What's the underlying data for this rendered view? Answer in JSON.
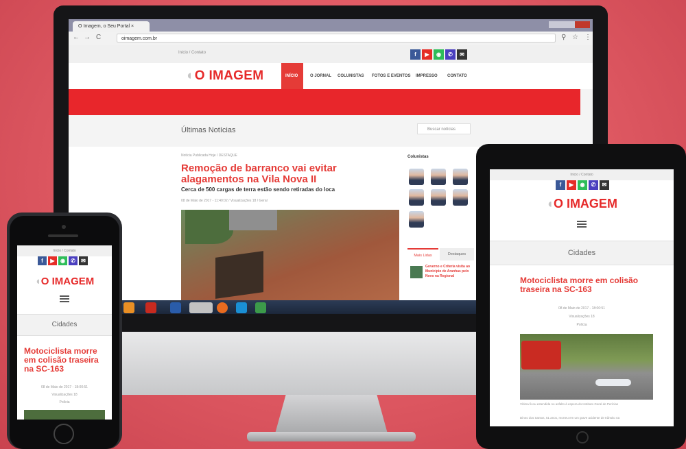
{
  "browser": {
    "tab_title": "O Imagem, o Seu Portal",
    "url": "oimagem.com.br"
  },
  "site": {
    "breadcrumb": "Inicio / Contato",
    "logo": "O IMAGEM",
    "menu": [
      "INÍCIO",
      "O JORNAL",
      "COLUNISTAS",
      "FOTOS E EVENTOS",
      "IMPRESSO",
      "CONTATO"
    ],
    "section_title": "Últimas Notícias",
    "search_placeholder": "Buscar notícias",
    "article": {
      "meta_top": "Notícia Publicada Hoje / DESTAQUE",
      "title": "Remoção de barranco vai evitar alagamentos na Vila Nova II",
      "subtitle": "Cerca de 500 cargas de terra estão sendo retiradas do loca",
      "meta": "08 de Maio de 2017 - 11:40:02 / Visualizações 18 / Geral"
    },
    "sidebar": {
      "title": "Colunistas",
      "tab_more_read": "Mais Lidas",
      "tab_highlights": "Destaques",
      "mini_headline": "Governo e Criteria visita ao Município de Aranhas pelo Novo na Regional"
    }
  },
  "social_colors": {
    "facebook": "#3b5998",
    "youtube": "#e52d27",
    "whatsapp": "#2ebd59",
    "phone": "#4a3fbf",
    "email": "#333333"
  },
  "mobile": {
    "category": "Cidades",
    "title": "Motociclista morre em colisão traseira na SC-163",
    "meta_date": "08 de Maio de 2017 - 18:00:51",
    "meta_views": "Visualizações 18",
    "meta_cat": "Polícia",
    "caption": "Vítima ficou estendida no asfalto à espera do Instituto Geral de Perícias",
    "body": "Dinno dos Santos, 51 anos, morreu em um grave acidente de trânsito na"
  },
  "accent_color": "#e53b37"
}
